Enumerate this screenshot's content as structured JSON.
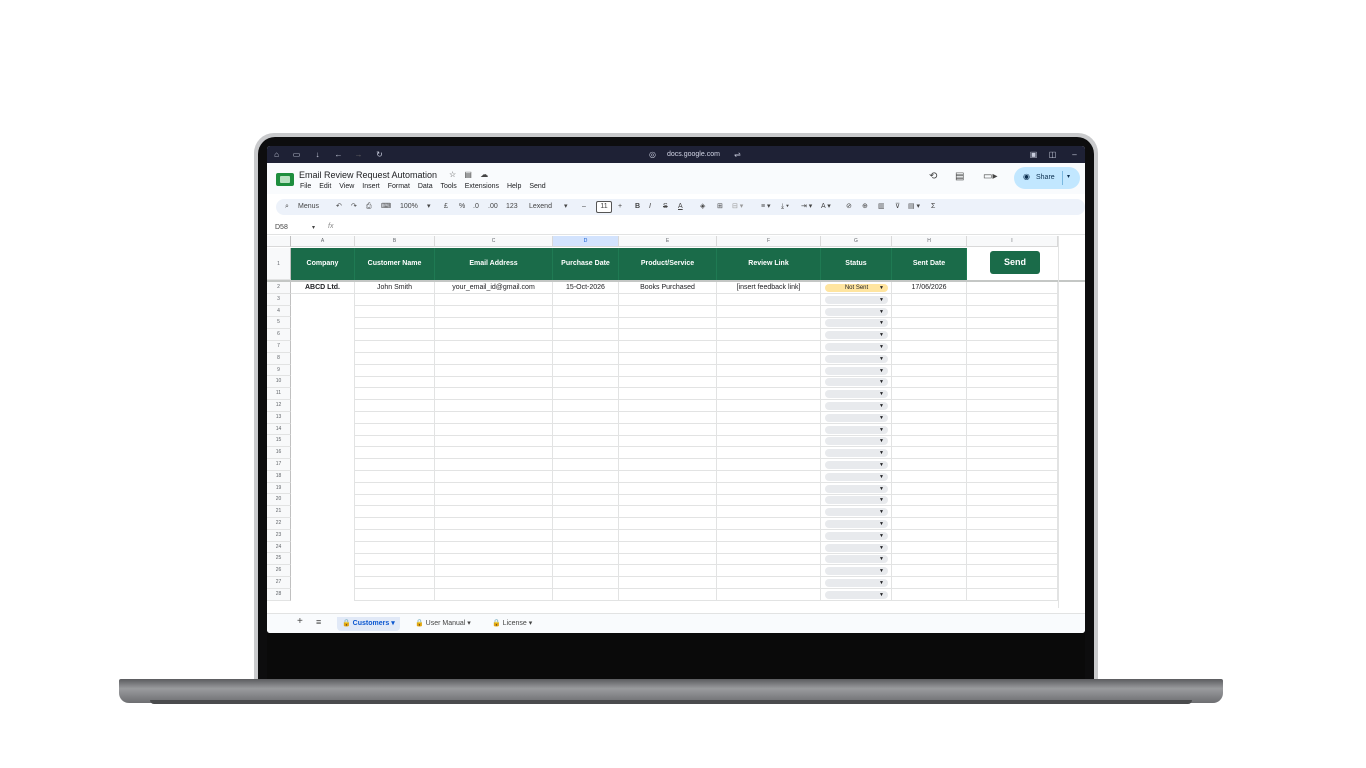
{
  "browser": {
    "url": "docs.google.com"
  },
  "doc": {
    "title": "Email Review Request Automation",
    "menu": [
      "File",
      "Edit",
      "View",
      "Insert",
      "Format",
      "Data",
      "Tools",
      "Extensions",
      "Help",
      "Send"
    ],
    "share_label": "Share"
  },
  "toolbar": {
    "menus_label": "Menus",
    "zoom": "100%",
    "currency": "£",
    "percent": "%",
    "dec_less": ".0",
    "dec_more": ".00",
    "format_123": "123",
    "font": "Lexend",
    "font_size": "11"
  },
  "formula_bar": {
    "cell_ref": "D58",
    "fx": "fx"
  },
  "columns": [
    "A",
    "B",
    "C",
    "D",
    "E",
    "F",
    "G",
    "H",
    "I"
  ],
  "header_row": {
    "row_number": "1",
    "cells": [
      "Company",
      "Customer Name",
      "Email Address",
      "Purchase Date",
      "Product/Service",
      "Review Link",
      "Status",
      "Sent Date"
    ],
    "send_button": "Send"
  },
  "data_rows": [
    {
      "row_number": "2",
      "company": "ABCD Ltd.",
      "customer_name": "John Smith",
      "email": "your_email_id@gmail.com",
      "purchase_date": "15-Oct-2026",
      "product": "Books Purchased",
      "review_link": "[insert feedback link]",
      "status": "Not Sent",
      "sent_date": "17/06/2026"
    }
  ],
  "empty_row_numbers": [
    "3",
    "4",
    "5",
    "6",
    "7",
    "8",
    "9",
    "10",
    "11",
    "12",
    "13",
    "14",
    "15",
    "16",
    "17",
    "18",
    "19",
    "20",
    "21",
    "22",
    "23",
    "24",
    "25",
    "26",
    "27",
    "28"
  ],
  "sheet_tabs": [
    {
      "label": "Customers",
      "active": true
    },
    {
      "label": "User Manual",
      "active": false
    },
    {
      "label": "License",
      "active": false
    }
  ],
  "colors": {
    "header_green": "#1a6b49",
    "status_not_sent": "#ffe5a0",
    "share_blue": "#c2e7ff"
  }
}
